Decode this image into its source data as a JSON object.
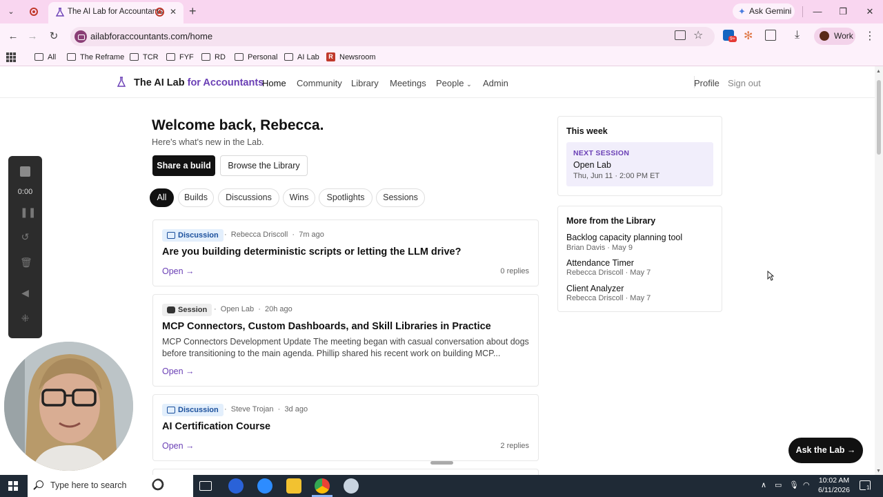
{
  "browser": {
    "tab_title": "The AI Lab for Accountants",
    "url": "ailabforaccountants.com/home",
    "ask_gemini": "Ask Gemini",
    "profile": "Work",
    "bookmarks": [
      "All",
      "The Reframe",
      "TCR",
      "FYF",
      "RD",
      "Personal",
      "AI Lab",
      "Newsroom"
    ]
  },
  "site": {
    "brand_main": "The AI Lab",
    "brand_accent": "for Accountants",
    "nav": [
      "Home",
      "Community",
      "Library",
      "Meetings",
      "People",
      "Admin"
    ],
    "profile": "Profile",
    "sign_out": "Sign out",
    "accent_color": "#6a3fb5"
  },
  "main": {
    "welcome": "Welcome back, Rebecca.",
    "subtitle": "Here's what's new in the Lab.",
    "share_build": "Share a build",
    "browse_library": "Browse the Library",
    "filters": [
      "All",
      "Builds",
      "Discussions",
      "Wins",
      "Spotlights",
      "Sessions"
    ],
    "active_filter": "All"
  },
  "feed": [
    {
      "type": "Discussion",
      "author": "Rebecca Driscoll",
      "time": "7m ago",
      "title": "Are you building deterministic scripts or letting the LLM drive?",
      "open": "Open →",
      "replies": "0 replies"
    },
    {
      "type": "Session",
      "author": "Open Lab",
      "time": "20h ago",
      "title": "MCP Connectors, Custom Dashboards, and Skill Libraries in Practice",
      "body": "MCP Connectors Development Update The meeting began with casual conversation about dogs before transitioning to the main agenda. Phillip shared his recent work on building MCP...",
      "open": "Open →"
    },
    {
      "type": "Discussion",
      "author": "Steve Trojan",
      "time": "3d ago",
      "title": "AI Certification Course",
      "open": "Open →",
      "replies": "2 replies"
    }
  ],
  "sidebar": {
    "this_week": "This week",
    "next_label": "NEXT SESSION",
    "next_name": "Open Lab",
    "next_when": "Thu, Jun 11 · 2:00 PM ET",
    "library_title": "More from the Library",
    "library": [
      {
        "title": "Backlog capacity planning tool",
        "meta": "Brian Davis · May 9"
      },
      {
        "title": "Attendance Timer",
        "meta": "Rebecca Driscoll · May 7"
      },
      {
        "title": "Client Analyzer",
        "meta": "Rebecca Driscoll · May 7"
      }
    ]
  },
  "recorder": {
    "time": "0:00"
  },
  "ask_lab": "Ask the Lab →",
  "taskbar": {
    "search_placeholder": "Type here to search",
    "time": "10:02 AM",
    "date": "6/11/2026",
    "notif_count": "1"
  }
}
